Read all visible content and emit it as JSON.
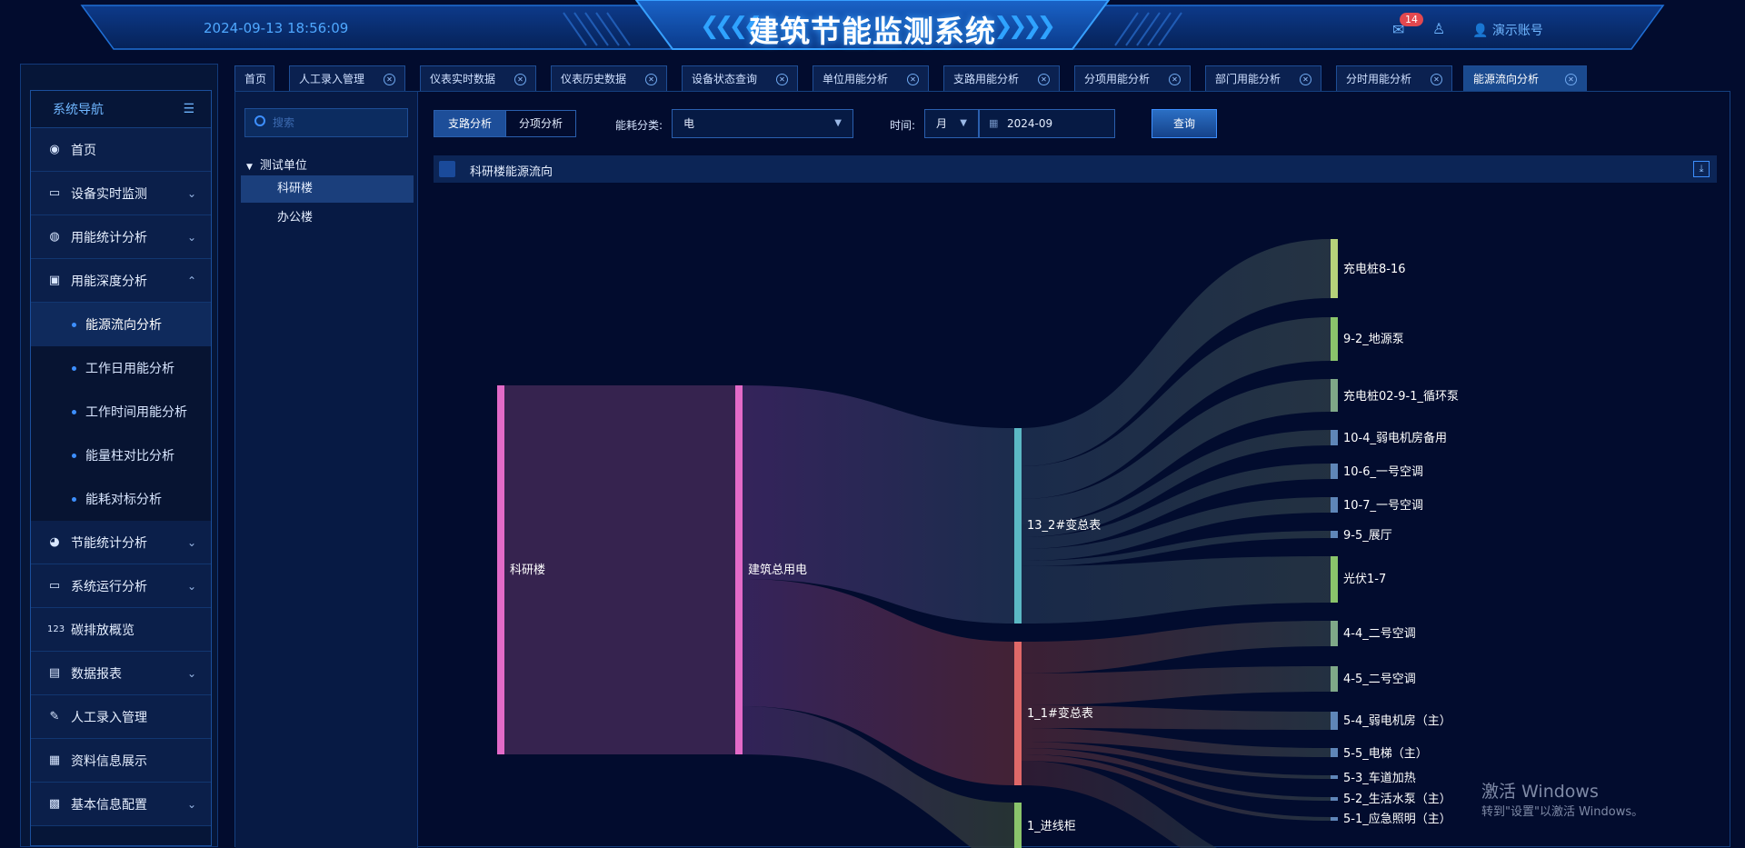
{
  "header": {
    "datetime": "2024-09-13 18:56:09",
    "title": "建筑节能监测系统",
    "chevrons_left": "❮❮❮❮",
    "chevrons_right": "❯❯❯❯",
    "message_count": "14",
    "account": "演示账号",
    "accent_color": "#2fa3ff"
  },
  "sidebar": {
    "title": "系统导航",
    "items": [
      {
        "label": "首页",
        "icon": "dashboard-icon"
      },
      {
        "label": "设备实时监测",
        "icon": "monitor-icon",
        "expand": "⌄"
      },
      {
        "label": "用能统计分析",
        "icon": "chart-icon",
        "expand": "⌄"
      },
      {
        "label": "用能深度分析",
        "icon": "analysis-icon",
        "expand": "⌃"
      }
    ],
    "sub_items": [
      {
        "label": "能源流向分析"
      },
      {
        "label": "工作日用能分析"
      },
      {
        "label": "工作时间用能分析"
      },
      {
        "label": "能量柱对比分析"
      },
      {
        "label": "能耗对标分析"
      }
    ],
    "items_after": [
      {
        "label": "节能统计分析",
        "icon": "globe-icon",
        "expand": "⌄"
      },
      {
        "label": "系统运行分析",
        "icon": "monitor-icon",
        "expand": "⌄"
      },
      {
        "label": "碳排放概览",
        "icon": "counter-icon"
      },
      {
        "label": "数据报表",
        "icon": "report-icon",
        "expand": "⌄"
      },
      {
        "label": "人工录入管理",
        "icon": "edit-icon"
      },
      {
        "label": "资料信息展示",
        "icon": "info-icon"
      },
      {
        "label": "基本信息配置",
        "icon": "config-icon",
        "expand": "⌄"
      }
    ]
  },
  "tabs": [
    {
      "label": "首页"
    },
    {
      "label": "人工录入管理"
    },
    {
      "label": "仪表实时数据"
    },
    {
      "label": "仪表历史数据"
    },
    {
      "label": "设备状态查询"
    },
    {
      "label": "单位用能分析"
    },
    {
      "label": "支路用能分析"
    },
    {
      "label": "分项用能分析"
    },
    {
      "label": "部门用能分析"
    },
    {
      "label": "分时用能分析"
    },
    {
      "label": "能源流向分析"
    }
  ],
  "tree": {
    "search_placeholder": "搜索",
    "root": "测试单位",
    "nodes": [
      "科研楼",
      "办公楼"
    ]
  },
  "toolbar": {
    "seg_branch": "支路分析",
    "seg_item": "分项分析",
    "energy_label": "能耗分类:",
    "energy_value": "电",
    "time_label": "时间:",
    "period_value": "月",
    "date_value": "2024-09",
    "query_label": "查询"
  },
  "panel": {
    "title": "科研楼能源流向"
  },
  "chart_data": {
    "type": "sankey",
    "nodes": [
      {
        "name": "科研楼",
        "color": "#e36ac8"
      },
      {
        "name": "建筑总用电",
        "color": "#e36ac8"
      },
      {
        "name": "13_2#变总表",
        "color": "#5bb8c4"
      },
      {
        "name": "1_1#变总表",
        "color": "#e06868"
      },
      {
        "name": "1_进线柜",
        "color": "#8ac46b"
      },
      {
        "name": "充电桩8-16",
        "color": "#b6d27a"
      },
      {
        "name": "9-2_地源泵",
        "color": "#8ac46b"
      },
      {
        "name": "充电桩02-9-1_循环泵",
        "color": "#7fa888"
      },
      {
        "name": "10-4_弱电机房备用",
        "color": "#5f86b8"
      },
      {
        "name": "10-6_一号空调",
        "color": "#5f86b8"
      },
      {
        "name": "10-7_一号空调",
        "color": "#5f86b8"
      },
      {
        "name": "9-5_展厅",
        "color": "#5f86b8"
      },
      {
        "name": "光伏1-7",
        "color": "#8ac46b"
      },
      {
        "name": "4-4_二号空调",
        "color": "#7fa888"
      },
      {
        "name": "4-5_二号空调",
        "color": "#7fa888"
      },
      {
        "name": "5-4_弱电机房（主）",
        "color": "#5f86b8"
      },
      {
        "name": "5-5_电梯（主）",
        "color": "#5f86b8"
      },
      {
        "name": "5-3_车道加热",
        "color": "#5f86b8"
      },
      {
        "name": "5-2_生活水泵（主）",
        "color": "#5f86b8"
      },
      {
        "name": "5-1_应急照明（主）",
        "color": "#5f86b8"
      }
    ]
  },
  "watermark": {
    "line1": "激活 Windows",
    "line2": "转到\"设置\"以激活 Windows。"
  }
}
